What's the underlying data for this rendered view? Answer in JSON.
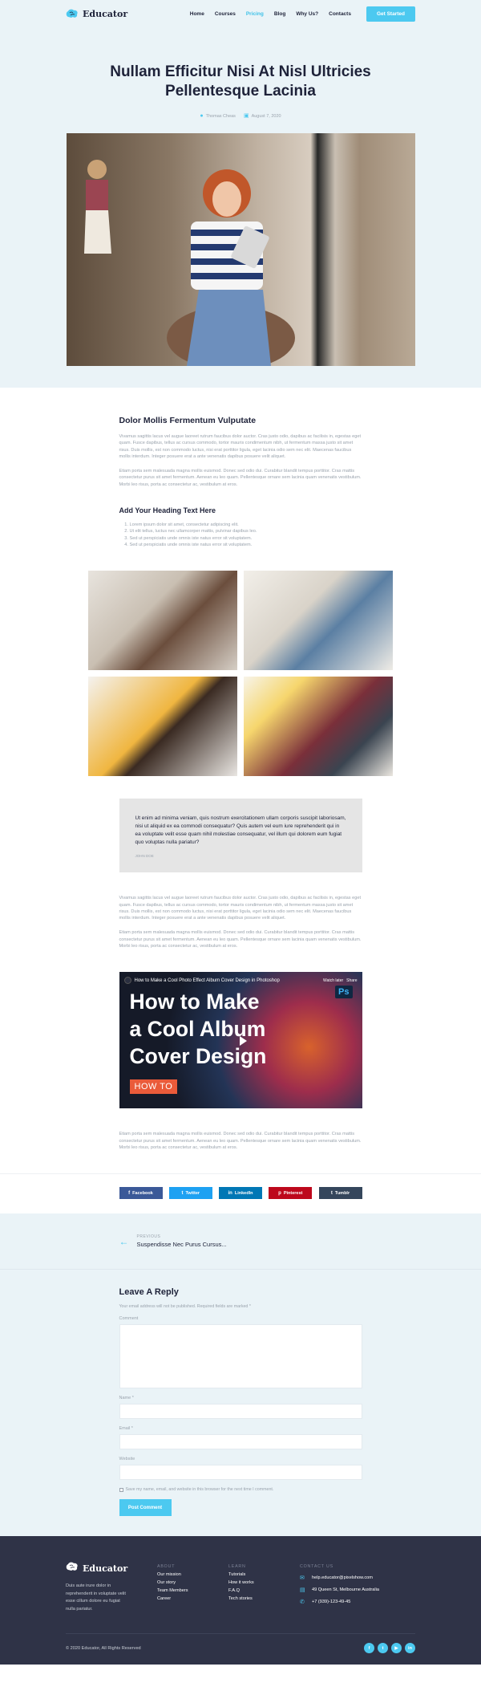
{
  "nav": {
    "logo": "Educator",
    "items": [
      "Home",
      "Courses",
      "Pricing",
      "Blog",
      "Why Us?",
      "Contacts"
    ],
    "active": "Pricing",
    "cta": "Get Started"
  },
  "hero": {
    "title": "Nullam Efficitur Nisi At Nisl Ultricies Pellentesque Lacinia",
    "author": "Thomas Cheas",
    "date": "August 7, 2020"
  },
  "article": {
    "h1": "Dolor Mollis Fermentum Vulputate",
    "p1": "Vivamus sagittis lacus vel augue laoreet rutrum faucibus dolor auctor. Cras justo odio, dapibus ac facilisis in, egestas eget quam. Fusce dapibus, tellus ac cursus commodo, tortor mauris condimentum nibh, ut fermentum massa justo sit amet risus. Duis mollis, est non commodo luctus, nisi erat porttitor ligula, eget lacinia odio sem nec elit. Maecenas faucibus mollis interdum. Integer posuere erat a ante venenatis dapibus posuere velit aliquet.",
    "p2": "Etiam porta sem malesuada magna mollis euismod. Donec sed odio dui. Curabitur blandit tempus porttitor. Cras mattis consectetur purus sit amet fermentum. Aenean eu leo quam. Pellentesque ornare sem lacinia quam venenatis vestibulum. Morbi leo risus, porta ac consectetur ac, vestibulum at eros.",
    "h2": "Add Your Heading Text Here",
    "list": [
      "Lorem ipsum dolor sit amet, consectetur adipiscing elit.",
      "Ut elit tellus, luctus nec ullamcorper mattis, pulvinar dapibus leo.",
      "Sed ut perspiciatis unde omnis iste natus error sit voluptatem.",
      "Sed ut perspiciatis unde omnis iste natus error sit voluptatem."
    ],
    "quote": "Ut enim ad minima veniam, quis nostrum exercitationem ullam corporis suscipit laboriosam, nisi ut aliquid ex ea commodi consequatur? Quis autem vel eum iure reprehenderit qui in ea voluptate velit esse quam nihil molestiae consequatur, vel illum qui dolorem eum fugiat quo voluptas nulla pariatur?",
    "quote_by": "JOHN DOE",
    "p3": "Vivamus sagittis lacus vel augue laoreet rutrum faucibus dolor auctor. Cras justo odio, dapibus ac facilisis in, egestas eget quam. Fusce dapibus, tellus ac cursus commodo, tortor mauris condimentum nibh, ut fermentum massa justo sit amet risus. Duis mollis, est non commodo luctus, nisi erat porttitor ligula, eget lacinia odio sem nec elit. Maecenas faucibus mollis interdum. Integer posuere erat a ante venenatis dapibus posuere velit aliquet.",
    "p4": "Etiam porta sem malesuada magna mollis euismod. Donec sed odio dui. Curabitur blandit tempus porttitor. Cras mattis consectetur purus sit amet fermentum. Aenean eu leo quam. Pellentesque ornare sem lacinia quam venenatis vestibulum. Morbi leo risus, porta ac consectetur ac, vestibulum at eros.",
    "p5": "Etiam porta sem malesuada magna mollis euismod. Donec sed odio dui. Curabitur blandit tempus porttitor. Cras mattis consectetur purus sit amet fermentum. Aenean eu leo quam. Pellentesque ornare sem lacinia quam venenatis vestibulum. Morbi leo risus, porta ac consectetur ac, vestibulum at eros."
  },
  "video": {
    "title": "How to Make a Cool Photo Effect Album Cover Design in Photoshop",
    "watch": "Watch later",
    "share": "Share",
    "big1": "How to Make",
    "big2": "a Cool Album",
    "big3": "Cover Design",
    "badge": "HOW TO",
    "ps": "Ps"
  },
  "share": [
    {
      "label": "Facebook",
      "icon": "f",
      "color": "#3b5998"
    },
    {
      "label": "Twitter",
      "icon": "t",
      "color": "#1da1f2"
    },
    {
      "label": "LinkedIn",
      "icon": "in",
      "color": "#0077b5"
    },
    {
      "label": "Pinterest",
      "icon": "p",
      "color": "#bd081c"
    },
    {
      "label": "Tumblr",
      "icon": "t",
      "color": "#35465c"
    }
  ],
  "prev": {
    "label": "PREVIOUS",
    "title": "Suspendisse Nec Purus Cursus..."
  },
  "reply": {
    "title": "Leave A Reply",
    "note": "Your email address will not be published. Required fields are marked *",
    "comment": "Comment",
    "name": "Name *",
    "email": "Email *",
    "website": "Website",
    "save": "Save my name, email, and website in this browser for the next time I comment.",
    "post": "Post Comment"
  },
  "footer": {
    "logo": "Educator",
    "about": "Duis aute irure dolor in reprehenderit in voluptate velit esse cillum dolore eu fugiat nulla pariatur.",
    "about_h": "ABOUT",
    "about_links": [
      "Our mission",
      "Our story",
      "Team Members",
      "Career"
    ],
    "learn_h": "LEARN",
    "learn_links": [
      "Tutorials",
      "How it works",
      "F.A.Q",
      "Tech stories"
    ],
    "contact_h": "CONTACT US",
    "email": "help.educator@pixelshow.com",
    "address": "49 Queen St, Melbourne Australia",
    "phone": "+7 (939)-123-49-45",
    "copyright": "© 2020 Educator, All Rights Reserved"
  },
  "colors": {
    "accent": "#4cc9f0",
    "dark": "#1e2239",
    "footer": "#2f3347",
    "light_bg": "#eaf3f7"
  }
}
